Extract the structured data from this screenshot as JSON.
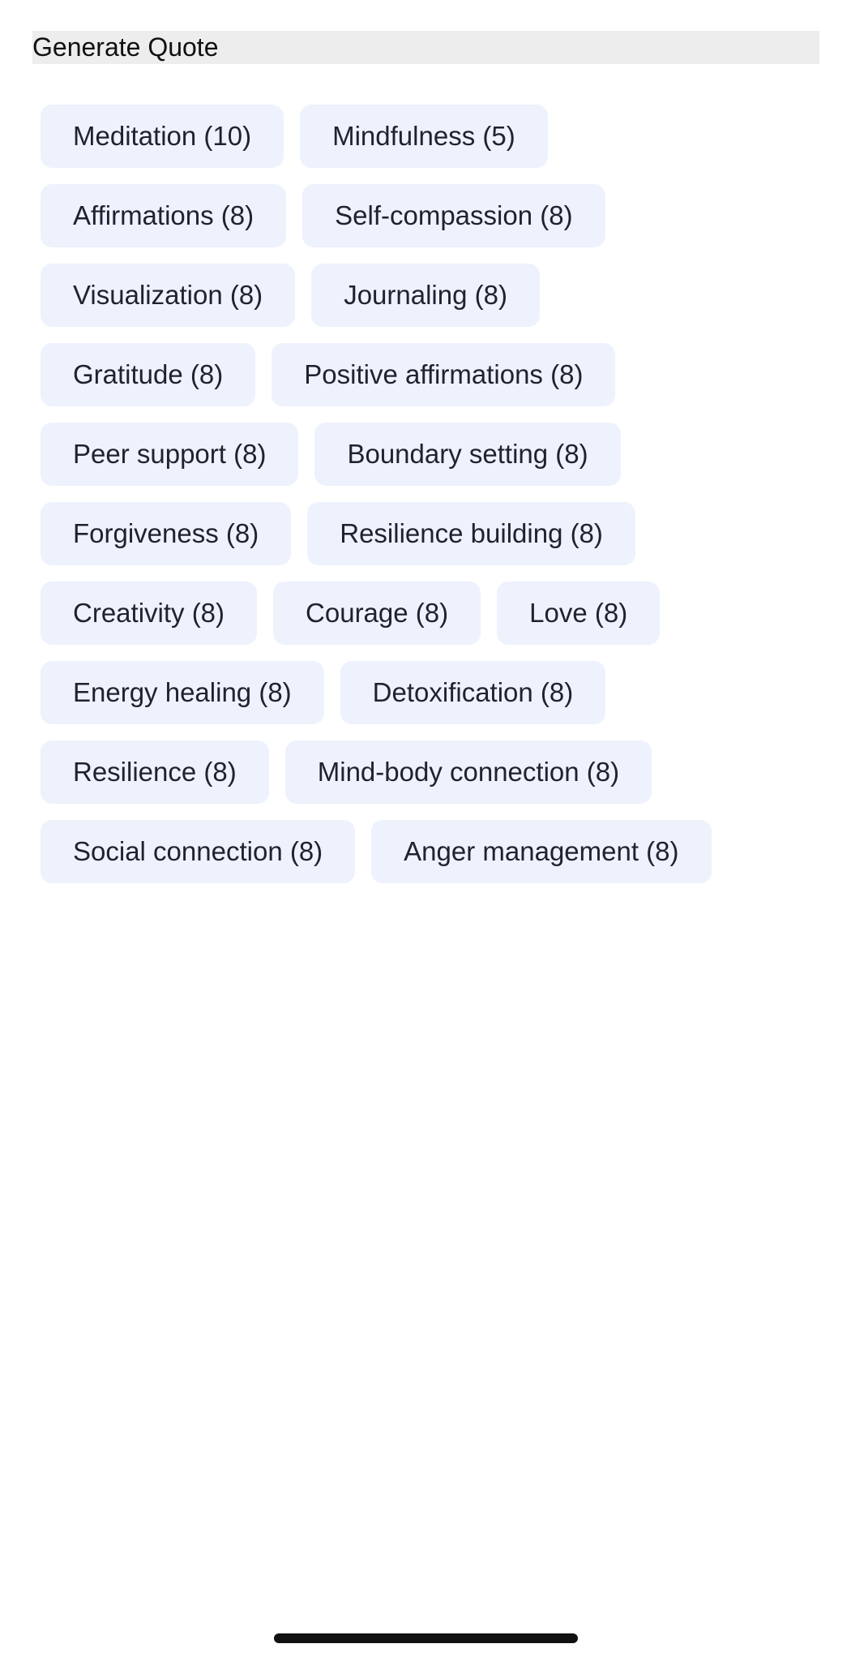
{
  "generate_button": {
    "label": "Generate Quote"
  },
  "tags": [
    [
      "Meditation (10)",
      "Mindfulness (5)"
    ],
    [
      "Affirmations (8)",
      "Self-compassion (8)"
    ],
    [
      "Visualization (8)",
      "Journaling (8)"
    ],
    [
      "Gratitude (8)",
      "Positive affirmations (8)"
    ],
    [
      "Peer support (8)",
      "Boundary setting (8)"
    ],
    [
      "Forgiveness (8)",
      "Resilience building (8)"
    ],
    [
      "Creativity (8)",
      "Courage (8)",
      "Love (8)"
    ],
    [
      "Energy healing (8)",
      "Detoxification (8)"
    ],
    [
      "Resilience (8)",
      "Mind-body connection (8)"
    ],
    [
      "Social connection (8)",
      "Anger management (8)"
    ]
  ],
  "colors": {
    "tag_background": "#eef2fd",
    "tag_text": "#1f2230",
    "generate_bar_background": "#ededed"
  }
}
